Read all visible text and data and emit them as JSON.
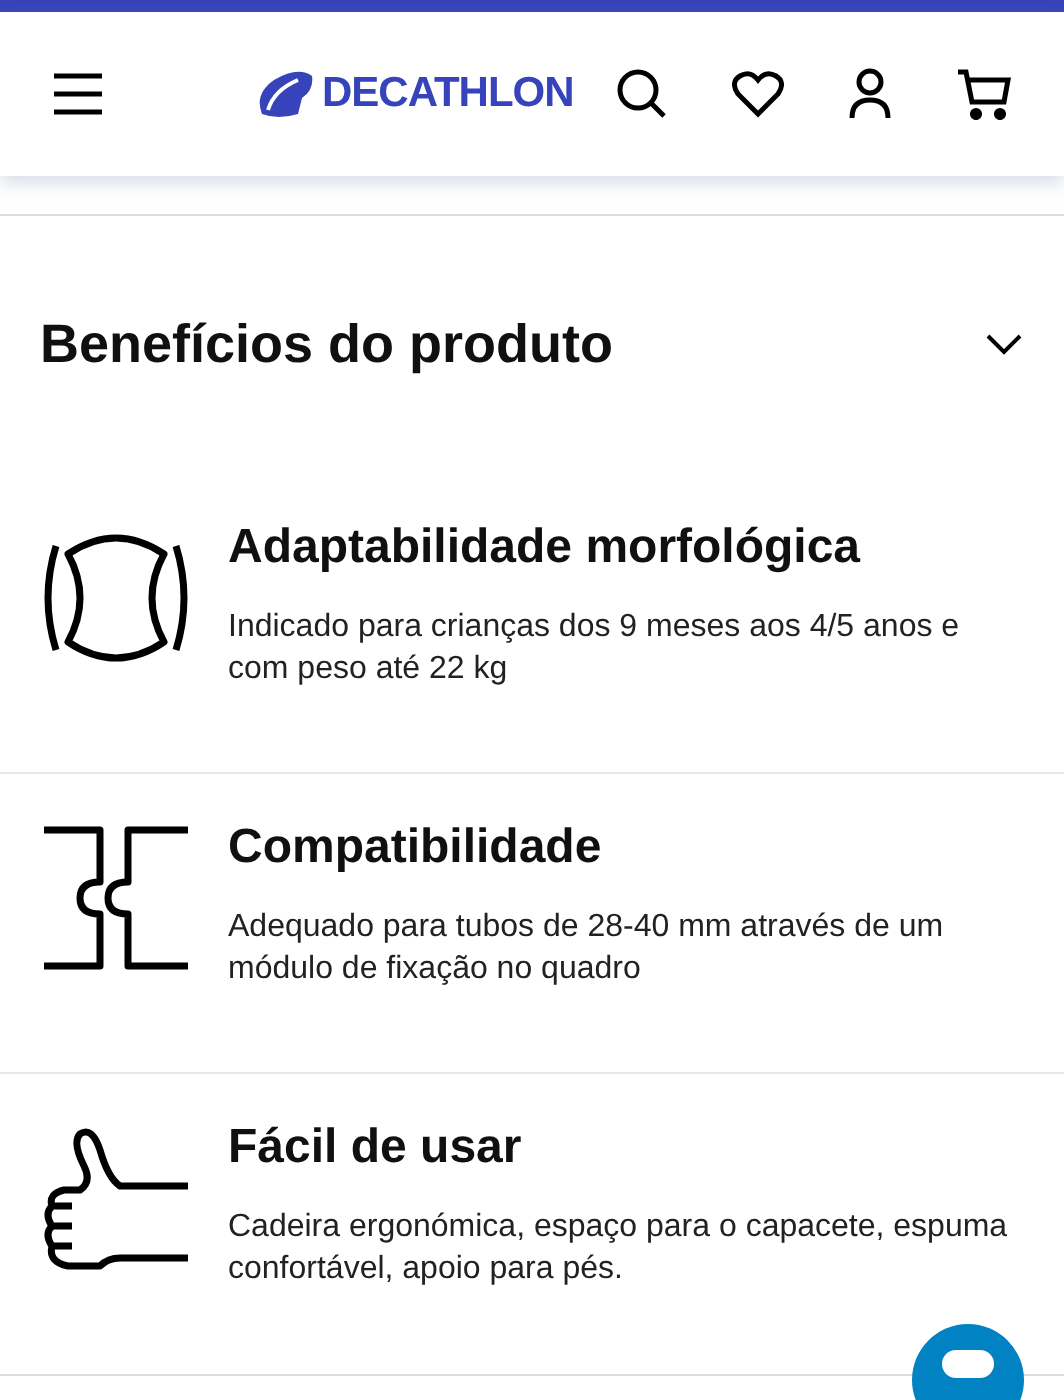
{
  "header": {
    "logo_text": "DECATHLON"
  },
  "section": {
    "title": "Benefícios do produto",
    "expanded": true
  },
  "benefits": [
    {
      "kind": "body",
      "title": "Adaptabilidade morfológica",
      "description": "Indicado para crianças dos 9 meses aos 4/5 anos e com peso até 22 kg"
    },
    {
      "kind": "puzzle",
      "title": "Compatibilidade",
      "description": "Adequado para tubos de 28-40 mm através de um módulo de fixação no quadro"
    },
    {
      "kind": "thumb",
      "title": "Fácil de usar",
      "description": "Cadeira ergonómica, espaço para o capacete, espuma confortável, apoio para pés."
    }
  ]
}
